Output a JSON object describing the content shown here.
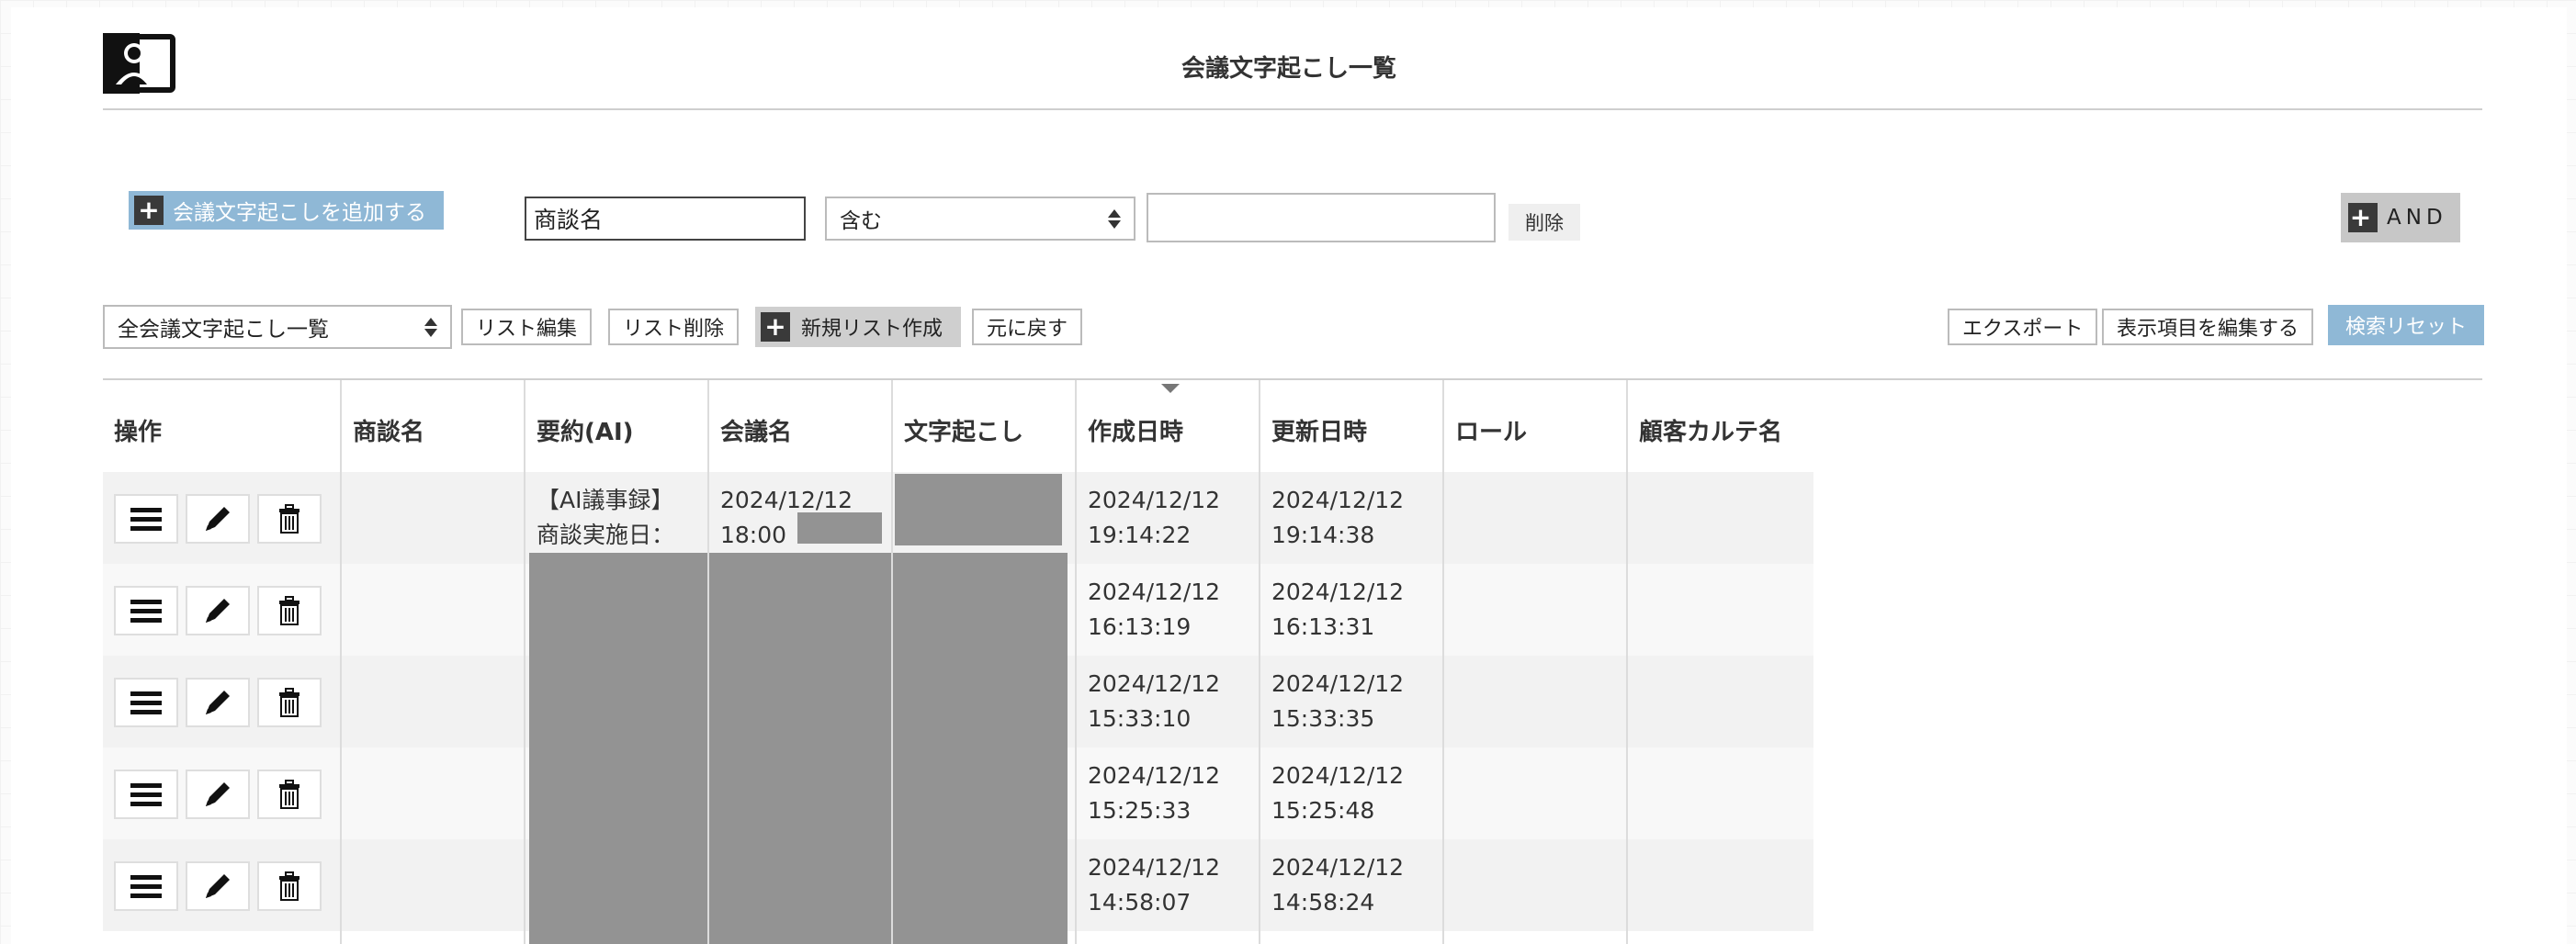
{
  "header": {
    "title": "会議文字起こし一覧",
    "logo_icon": "person-card-icon"
  },
  "add_button": {
    "label": "会議文字起こしを追加する",
    "icon": "plus-icon"
  },
  "filter": {
    "field_value": "商談名",
    "operator_value": "含む",
    "value": "",
    "delete_label": "削除",
    "and_label": "AND"
  },
  "list_toolbar": {
    "selected_list": "全会議文字起こし一覧",
    "edit_list_label": "リスト編集",
    "delete_list_label": "リスト削除",
    "new_list_label": "新規リスト作成",
    "revert_label": "元に戻す",
    "export_label": "エクスポート",
    "edit_columns_label": "表示項目を編集する",
    "search_reset_label": "検索リセット"
  },
  "table": {
    "columns": [
      "操作",
      "商談名",
      "要約(AI)",
      "会議名",
      "文字起こし",
      "作成日時",
      "更新日時",
      "ロール",
      "顧客カルテ名"
    ],
    "sorted_column": "作成日時",
    "rows": [
      {
        "summary_line1": "【AI議事録】",
        "summary_line2": "商談実施日：",
        "meeting_line1": "2024/12/12",
        "meeting_line2": "18:00",
        "created_date": "2024/12/12",
        "created_time": "19:14:22",
        "updated_date": "2024/12/12",
        "updated_time": "19:14:38"
      },
      {
        "summary_line1": "",
        "summary_line2": "",
        "meeting_line1": "",
        "meeting_line2": "",
        "created_date": "2024/12/12",
        "created_time": "16:13:19",
        "updated_date": "2024/12/12",
        "updated_time": "16:13:31"
      },
      {
        "summary_line1": "",
        "summary_line2": "",
        "meeting_line1": "",
        "meeting_line2": "",
        "created_date": "2024/12/12",
        "created_time": "15:33:10",
        "updated_date": "2024/12/12",
        "updated_time": "15:33:35"
      },
      {
        "summary_line1": "",
        "summary_line2": "",
        "meeting_line1": "",
        "meeting_line2": "",
        "created_date": "2024/12/12",
        "created_time": "15:25:33",
        "updated_date": "2024/12/12",
        "updated_time": "15:25:48"
      },
      {
        "summary_line1": "",
        "summary_line2": "",
        "meeting_line1": "",
        "meeting_line2": "",
        "created_date": "2024/12/12",
        "created_time": "14:58:07",
        "updated_date": "2024/12/12",
        "updated_time": "14:58:24"
      }
    ],
    "row_actions": [
      "menu-icon",
      "pencil-icon",
      "trash-icon"
    ]
  },
  "colors": {
    "accent": "#8fb8d6",
    "redaction": "#939393",
    "dark_button": "#3a3a3a"
  }
}
